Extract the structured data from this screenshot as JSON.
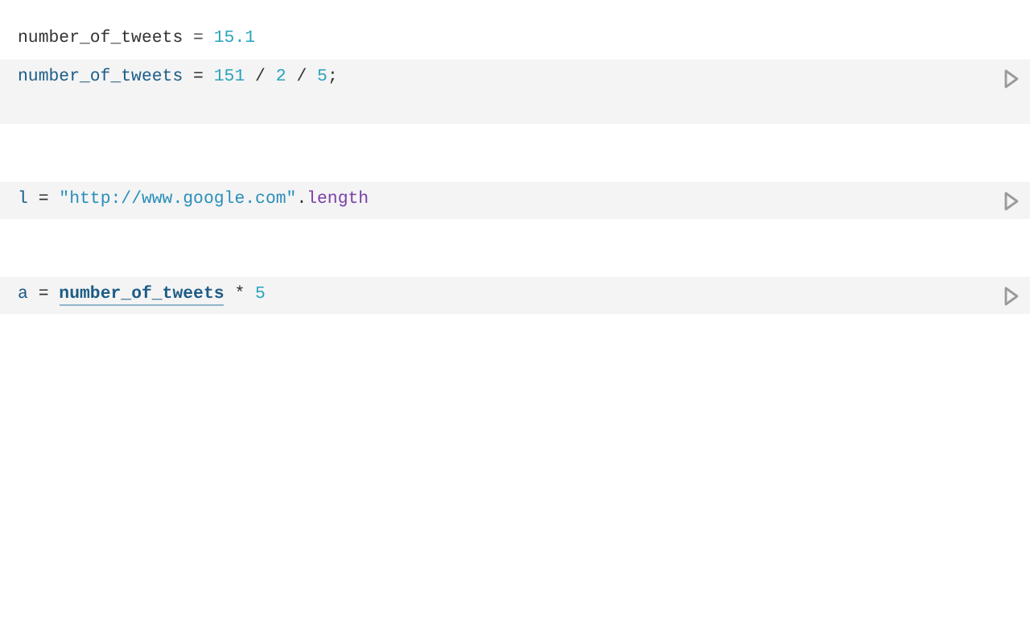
{
  "cells": [
    {
      "output": [
        {
          "text": "number_of_tweets",
          "kind": "name"
        },
        {
          "text": " = ",
          "kind": "op"
        },
        {
          "text": "15.1",
          "kind": "num"
        }
      ],
      "code": [
        {
          "text": "number_of_tweets",
          "kind": "var"
        },
        {
          "text": " = ",
          "kind": "op"
        },
        {
          "text": "151",
          "kind": "num"
        },
        {
          "text": " / ",
          "kind": "op"
        },
        {
          "text": "2",
          "kind": "num"
        },
        {
          "text": " / ",
          "kind": "op"
        },
        {
          "text": "5",
          "kind": "num"
        },
        {
          "text": ";",
          "kind": "op"
        }
      ]
    },
    {
      "code": [
        {
          "text": "l",
          "kind": "var"
        },
        {
          "text": " = ",
          "kind": "op"
        },
        {
          "text": "\"http://www.google.com\"",
          "kind": "str"
        },
        {
          "text": ".",
          "kind": "op"
        },
        {
          "text": "length",
          "kind": "prop"
        }
      ]
    },
    {
      "code": [
        {
          "text": "a",
          "kind": "var"
        },
        {
          "text": " = ",
          "kind": "op"
        },
        {
          "text": "number_of_tweets",
          "kind": "ref"
        },
        {
          "text": " * ",
          "kind": "op"
        },
        {
          "text": "5",
          "kind": "num"
        }
      ]
    }
  ]
}
